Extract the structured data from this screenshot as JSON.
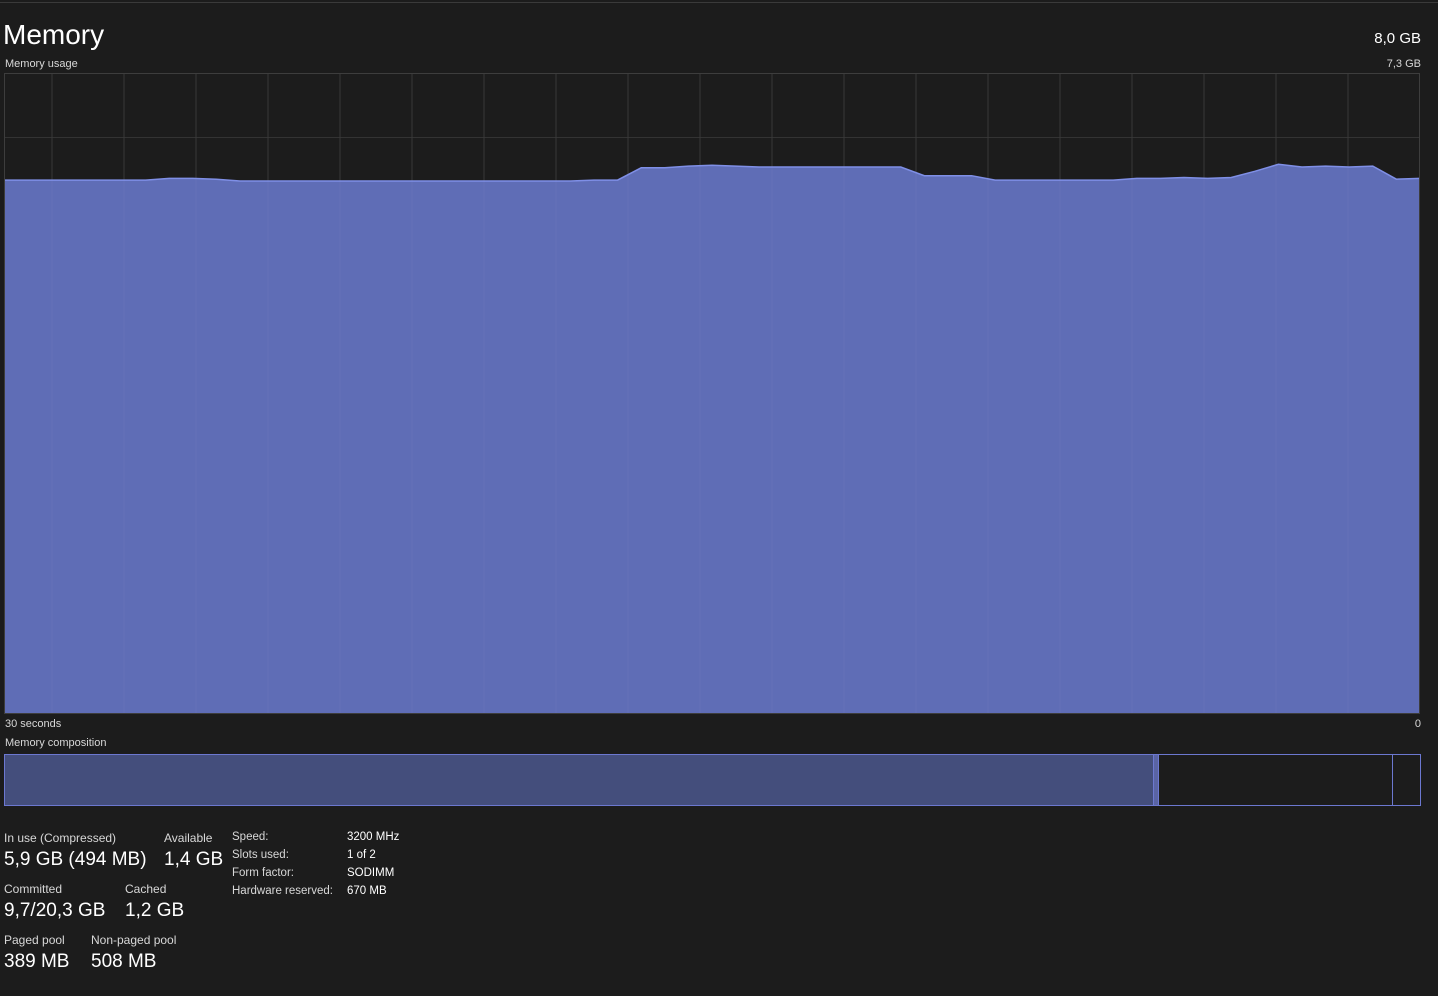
{
  "header": {
    "title": "Memory",
    "total": "8,0 GB"
  },
  "graph": {
    "label": "Memory usage",
    "max_label": "7,3 GB",
    "time_left": "30 seconds",
    "time_right": "0",
    "colors": {
      "fill": "#5f6db6",
      "line": "#7f8fe6",
      "grid": "#333333",
      "border": "#3d3d3d"
    },
    "usage_gb_max": 7.3,
    "usage_series_gb": [
      6.08,
      6.08,
      6.08,
      6.08,
      6.08,
      6.08,
      6.08,
      6.1,
      6.1,
      6.09,
      6.07,
      6.07,
      6.07,
      6.07,
      6.07,
      6.07,
      6.07,
      6.07,
      6.07,
      6.07,
      6.07,
      6.07,
      6.07,
      6.07,
      6.07,
      6.08,
      6.08,
      6.22,
      6.22,
      6.24,
      6.25,
      6.24,
      6.23,
      6.23,
      6.23,
      6.23,
      6.23,
      6.23,
      6.23,
      6.13,
      6.13,
      6.13,
      6.08,
      6.08,
      6.08,
      6.08,
      6.08,
      6.08,
      6.1,
      6.1,
      6.11,
      6.1,
      6.11,
      6.18,
      6.26,
      6.23,
      6.24,
      6.23,
      6.24,
      6.09,
      6.1
    ]
  },
  "composition": {
    "label": "Memory composition",
    "in_use_fraction": 0.811,
    "modified_fraction": 0.004,
    "standby_end_fraction": 0.98
  },
  "stats": {
    "in_use": {
      "label": "In use (Compressed)",
      "value": "5,9 GB (494 MB)"
    },
    "available": {
      "label": "Available",
      "value": "1,4 GB"
    },
    "committed": {
      "label": "Committed",
      "value": "9,7/20,3 GB"
    },
    "cached": {
      "label": "Cached",
      "value": "1,2 GB"
    },
    "paged_pool": {
      "label": "Paged pool",
      "value": "389 MB"
    },
    "non_paged_pool": {
      "label": "Non-paged pool",
      "value": "508 MB"
    }
  },
  "specs": {
    "speed": {
      "label": "Speed:",
      "value": "3200 MHz"
    },
    "slots": {
      "label": "Slots used:",
      "value": "1 of 2"
    },
    "form_factor": {
      "label": "Form factor:",
      "value": "SODIMM"
    },
    "hw_reserved": {
      "label": "Hardware reserved:",
      "value": "670 MB"
    }
  }
}
